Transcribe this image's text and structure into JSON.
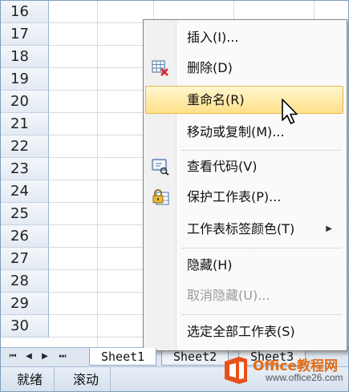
{
  "rows": [
    "16",
    "17",
    "18",
    "19",
    "20",
    "21",
    "22",
    "23",
    "24",
    "25",
    "26",
    "27",
    "28",
    "29",
    "30"
  ],
  "sheet_nav": [
    "⏮",
    "◀",
    "▶",
    "⏭"
  ],
  "sheet_tabs": [
    {
      "label": "Sheet1",
      "active": true
    },
    {
      "label": "Sheet2",
      "active": false
    },
    {
      "label": "Sheet3",
      "active": false
    }
  ],
  "status": {
    "ready": "就绪",
    "scroll": "滚动"
  },
  "context_menu": {
    "items": [
      {
        "label": "插入(I)...",
        "icon": "",
        "state": "normal"
      },
      {
        "label": "删除(D)",
        "icon": "delete-sheet-icon",
        "state": "normal"
      },
      {
        "label": "重命名(R)",
        "icon": "",
        "state": "highlighted"
      },
      {
        "label": "移动或复制(M)...",
        "icon": "",
        "state": "normal"
      },
      {
        "label": "查看代码(V)",
        "icon": "view-code-icon",
        "state": "normal"
      },
      {
        "label": "保护工作表(P)...",
        "icon": "protect-sheet-icon",
        "state": "normal"
      },
      {
        "label": "工作表标签颜色(T)",
        "icon": "",
        "state": "submenu"
      },
      {
        "label": "隐藏(H)",
        "icon": "",
        "state": "normal"
      },
      {
        "label": "取消隐藏(U)...",
        "icon": "",
        "state": "disabled"
      },
      {
        "label": "选定全部工作表(S)",
        "icon": "",
        "state": "normal"
      }
    ]
  },
  "watermark": {
    "brand": "Office教程网",
    "url": "www.office26.com"
  },
  "colors": {
    "highlight": "#ffe08a",
    "row_header": "#e3eaf3",
    "brand_orange": "#e46a12"
  }
}
